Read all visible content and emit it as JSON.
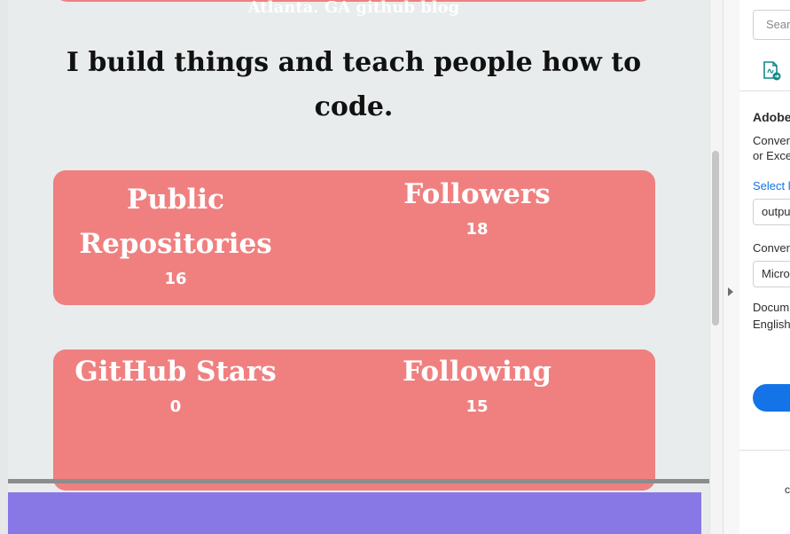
{
  "page": {
    "blog_caption": "Atlanta. GA github blog",
    "tagline": "I build things and teach people how to code.",
    "stats": [
      {
        "label": "Public Repositories",
        "value": "16"
      },
      {
        "label": "Followers",
        "value": "18"
      },
      {
        "label": "GitHub Stars",
        "value": "0"
      },
      {
        "label": "Following",
        "value": "15"
      }
    ]
  },
  "side_panel": {
    "search_placeholder": "Sear",
    "title": "Adobe",
    "desc_line1": "Conver",
    "desc_line2": "or Exce",
    "select_label": "Select l",
    "output_value": "outpu",
    "convert_label": "Conver",
    "convert_value": "Micro",
    "doc_label": "Docum",
    "doc_language": "English",
    "footer_text": "c"
  },
  "colors": {
    "card": "#f08080",
    "page_bg": "#e9ecec",
    "footer": "#8878e6",
    "accent": "#1473e6"
  }
}
